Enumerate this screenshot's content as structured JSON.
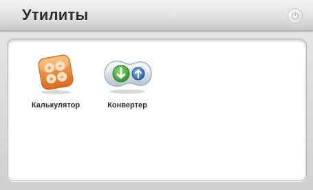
{
  "header": {
    "title": "Утилиты",
    "power_icon": "power-icon"
  },
  "apps": [
    {
      "label": "Калькулятор",
      "icon": "calculator-icon"
    },
    {
      "label": "Конвертер",
      "icon": "converter-icon"
    }
  ],
  "colors": {
    "calculator_orange": "#e8893a",
    "converter_green": "#3fa33a",
    "converter_blue": "#2f6fb3"
  }
}
